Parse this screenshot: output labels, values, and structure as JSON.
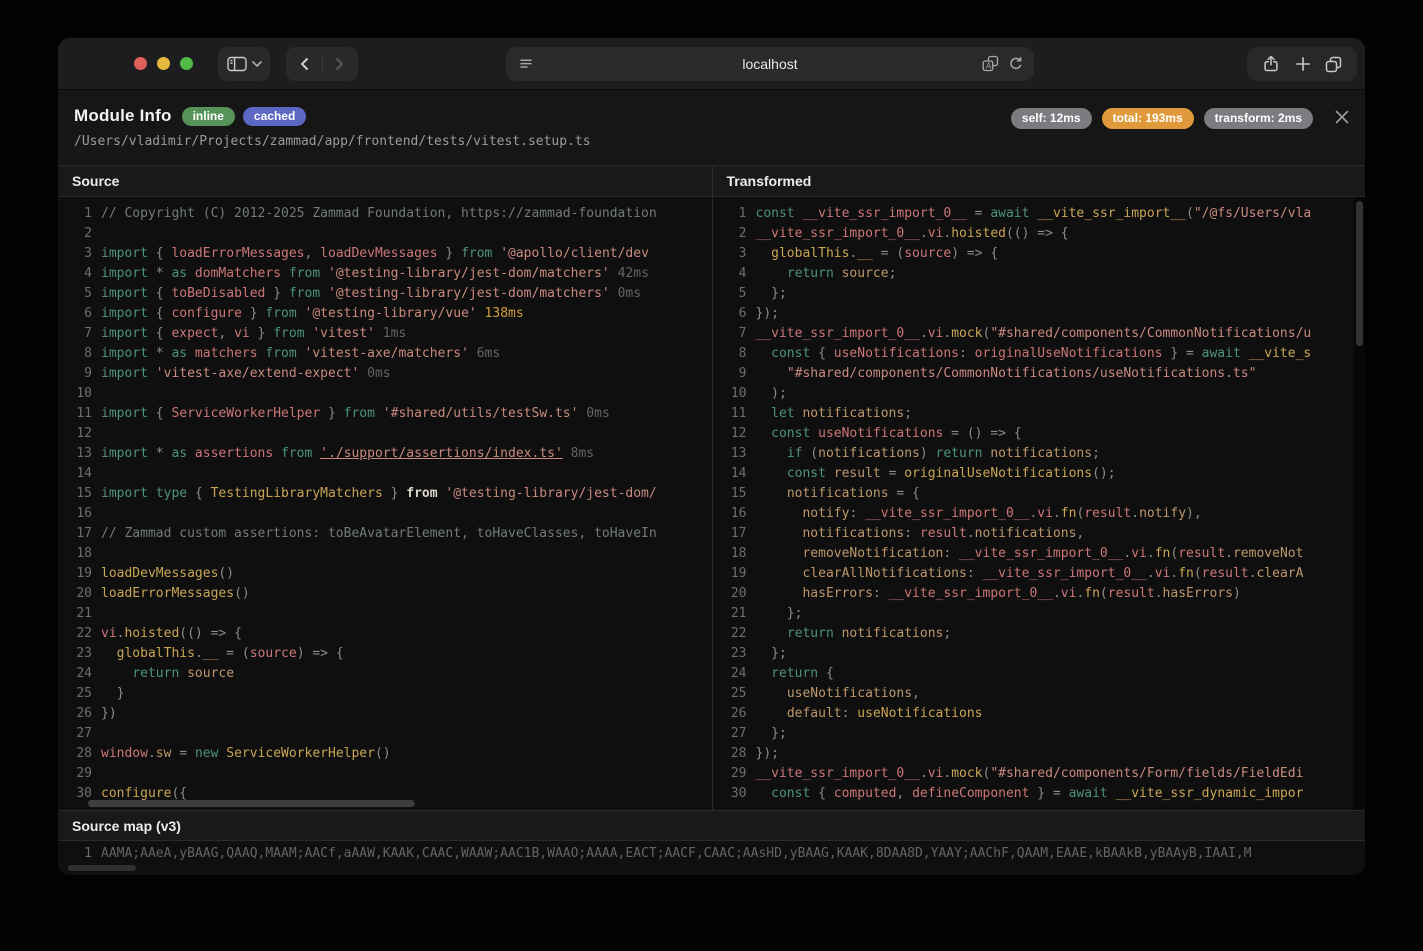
{
  "browser": {
    "url": "localhost",
    "icons": [
      "sidebar",
      "chevron-down",
      "back",
      "forward",
      "reader",
      "translate",
      "reload",
      "share",
      "new-tab",
      "tab-overview"
    ]
  },
  "header": {
    "title": "Module Info",
    "badges": [
      {
        "label": "inline",
        "color": "#569358"
      },
      {
        "label": "cached",
        "color": "#5c68c4"
      }
    ],
    "path": "/Users/vladimir/Projects/zammad/app/frontend/tests/vitest.setup.ts",
    "timings": [
      {
        "label": "self: 12ms",
        "color": "#7b7b80"
      },
      {
        "label": "total: 193ms",
        "color": "#e09a3c"
      },
      {
        "label": "transform: 2ms",
        "color": "#7b7b80"
      }
    ]
  },
  "panels": {
    "source": {
      "title": "Source",
      "lines": [
        [
          [
            "cm",
            "// Copyright (C) 2012-2025 Zammad Foundation, https://zammad-foundation"
          ]
        ],
        [],
        [
          [
            "kw",
            "import"
          ],
          [
            "pn",
            " { "
          ],
          [
            "id",
            "loadErrorMessages"
          ],
          [
            "pn",
            ", "
          ],
          [
            "id",
            "loadDevMessages"
          ],
          [
            "pn",
            " } "
          ],
          [
            "kw",
            "from"
          ],
          [
            "str",
            " '@apollo/client/dev"
          ]
        ],
        [
          [
            "kw",
            "import"
          ],
          [
            "pn",
            " * "
          ],
          [
            "kw",
            "as"
          ],
          [
            "id",
            " domMatchers "
          ],
          [
            "kw",
            "from"
          ],
          [
            "str",
            " '@testing-library/jest-dom/matchers'"
          ],
          [
            "tm",
            " 42ms"
          ]
        ],
        [
          [
            "kw",
            "import"
          ],
          [
            "pn",
            " { "
          ],
          [
            "id",
            "toBeDisabled"
          ],
          [
            "pn",
            " } "
          ],
          [
            "kw",
            "from"
          ],
          [
            "str",
            " '@testing-library/jest-dom/matchers'"
          ],
          [
            "tm",
            " 0ms"
          ]
        ],
        [
          [
            "kw",
            "import"
          ],
          [
            "pn",
            " { "
          ],
          [
            "id",
            "configure"
          ],
          [
            "pn",
            " } "
          ],
          [
            "kw",
            "from"
          ],
          [
            "str",
            " '@testing-library/vue'"
          ],
          [
            "hl",
            " 138ms"
          ]
        ],
        [
          [
            "kw",
            "import"
          ],
          [
            "pn",
            " { "
          ],
          [
            "id",
            "expect"
          ],
          [
            "pn",
            ", "
          ],
          [
            "id",
            "vi"
          ],
          [
            "pn",
            " } "
          ],
          [
            "kw",
            "from"
          ],
          [
            "str",
            " 'vitest'"
          ],
          [
            "tm",
            " 1ms"
          ]
        ],
        [
          [
            "kw",
            "import"
          ],
          [
            "pn",
            " * "
          ],
          [
            "kw",
            "as"
          ],
          [
            "id",
            " matchers "
          ],
          [
            "kw",
            "from"
          ],
          [
            "str",
            " 'vitest-axe/matchers'"
          ],
          [
            "tm",
            " 6ms"
          ]
        ],
        [
          [
            "kw",
            "import"
          ],
          [
            "str",
            " 'vitest-axe/extend-expect'"
          ],
          [
            "tm",
            " 0ms"
          ]
        ],
        [],
        [
          [
            "kw",
            "import"
          ],
          [
            "pn",
            " { "
          ],
          [
            "id",
            "ServiceWorkerHelper"
          ],
          [
            "pn",
            " } "
          ],
          [
            "kw",
            "from"
          ],
          [
            "str",
            " '#shared/utils/testSw.ts'"
          ],
          [
            "tm",
            " 0ms"
          ]
        ],
        [],
        [
          [
            "kw",
            "import"
          ],
          [
            "pn",
            " * "
          ],
          [
            "kw",
            "as"
          ],
          [
            "id",
            " assertions "
          ],
          [
            "kw",
            "from"
          ],
          [
            "pn",
            " "
          ],
          [
            "lk",
            "'./support/assertions/index.ts'"
          ],
          [
            "tm",
            " 8ms"
          ]
        ],
        [],
        [
          [
            "kw",
            "import type"
          ],
          [
            "pn",
            " { "
          ],
          [
            "fn",
            "TestingLibraryMatchers"
          ],
          [
            "pn",
            " } "
          ],
          [
            "wb",
            "from"
          ],
          [
            "str",
            " '@testing-library/jest-dom/"
          ]
        ],
        [],
        [
          [
            "cm",
            "// Zammad custom assertions: toBeAvatarElement, toHaveClasses, toHaveIn"
          ]
        ],
        [],
        [
          [
            "fn",
            "loadDevMessages"
          ],
          [
            "pn",
            "()"
          ]
        ],
        [
          [
            "fn",
            "loadErrorMessages"
          ],
          [
            "pn",
            "()"
          ]
        ],
        [],
        [
          [
            "id",
            "vi"
          ],
          [
            "pn",
            "."
          ],
          [
            "fn",
            "hoisted"
          ],
          [
            "pn",
            "(() => {"
          ]
        ],
        [
          [
            "pn",
            "  "
          ],
          [
            "fn",
            "globalThis"
          ],
          [
            "pn",
            "."
          ],
          [
            "vr",
            "__"
          ],
          [
            "pn",
            " = ("
          ],
          [
            "id",
            "source"
          ],
          [
            "pn",
            ") => {"
          ]
        ],
        [
          [
            "pn",
            "    "
          ],
          [
            "kw",
            "return"
          ],
          [
            "vr",
            " source"
          ]
        ],
        [
          [
            "pn",
            "  }"
          ]
        ],
        [
          [
            "pn",
            "})"
          ]
        ],
        [],
        [
          [
            "id",
            "window"
          ],
          [
            "pn",
            "."
          ],
          [
            "vr",
            "sw"
          ],
          [
            "pn",
            " = "
          ],
          [
            "kw",
            "new"
          ],
          [
            "fn",
            " ServiceWorkerHelper"
          ],
          [
            "pn",
            "()"
          ]
        ],
        [],
        [
          [
            "fn",
            "configure"
          ],
          [
            "pn",
            "({"
          ]
        ]
      ]
    },
    "transformed": {
      "title": "Transformed",
      "lines": [
        [
          [
            "kw",
            "const "
          ],
          [
            "id",
            "__vite_ssr_import_0__"
          ],
          [
            "pn",
            " = "
          ],
          [
            "kw",
            "await "
          ],
          [
            "fn",
            "__vite_ssr_import__"
          ],
          [
            "pn",
            "("
          ],
          [
            "str",
            "\"/@fs/Users/vla"
          ]
        ],
        [
          [
            "id",
            "__vite_ssr_import_0__"
          ],
          [
            "pn",
            "."
          ],
          [
            "id",
            "vi"
          ],
          [
            "pn",
            "."
          ],
          [
            "fn",
            "hoisted"
          ],
          [
            "pn",
            "(() => {"
          ]
        ],
        [
          [
            "pn",
            "  "
          ],
          [
            "fn",
            "globalThis"
          ],
          [
            "pn",
            "."
          ],
          [
            "vr",
            "__"
          ],
          [
            "pn",
            " = ("
          ],
          [
            "id",
            "source"
          ],
          [
            "pn",
            ") => {"
          ]
        ],
        [
          [
            "pn",
            "    "
          ],
          [
            "kw",
            "return"
          ],
          [
            "vr",
            " source"
          ],
          [
            "pn",
            ";"
          ]
        ],
        [
          [
            "pn",
            "  };"
          ]
        ],
        [
          [
            "pn",
            "});"
          ]
        ],
        [
          [
            "id",
            "__vite_ssr_import_0__"
          ],
          [
            "pn",
            "."
          ],
          [
            "id",
            "vi"
          ],
          [
            "pn",
            "."
          ],
          [
            "fn",
            "mock"
          ],
          [
            "pn",
            "("
          ],
          [
            "str",
            "\"#shared/components/CommonNotifications/u"
          ]
        ],
        [
          [
            "pn",
            "  "
          ],
          [
            "kw",
            "const"
          ],
          [
            "pn",
            " { "
          ],
          [
            "id",
            "useNotifications"
          ],
          [
            "pn",
            ": "
          ],
          [
            "id",
            "originalUseNotifications"
          ],
          [
            "pn",
            " } = "
          ],
          [
            "kw",
            "await "
          ],
          [
            "fn",
            "__vite_s"
          ]
        ],
        [
          [
            "pn",
            "    "
          ],
          [
            "str",
            "\"#shared/components/CommonNotifications/useNotifications.ts\""
          ]
        ],
        [
          [
            "pn",
            "  );"
          ]
        ],
        [
          [
            "pn",
            "  "
          ],
          [
            "kw",
            "let"
          ],
          [
            "vr",
            " notifications"
          ],
          [
            "pn",
            ";"
          ]
        ],
        [
          [
            "pn",
            "  "
          ],
          [
            "kw",
            "const "
          ],
          [
            "id",
            "useNotifications"
          ],
          [
            "pn",
            " = () => {"
          ]
        ],
        [
          [
            "pn",
            "    "
          ],
          [
            "kw",
            "if"
          ],
          [
            "pn",
            " ("
          ],
          [
            "vr",
            "notifications"
          ],
          [
            "pn",
            ") "
          ],
          [
            "kw",
            "return"
          ],
          [
            "vr",
            " notifications"
          ],
          [
            "pn",
            ";"
          ]
        ],
        [
          [
            "pn",
            "    "
          ],
          [
            "kw",
            "const "
          ],
          [
            "vr",
            "result"
          ],
          [
            "pn",
            " = "
          ],
          [
            "fn",
            "originalUseNotifications"
          ],
          [
            "pn",
            "();"
          ]
        ],
        [
          [
            "pn",
            "    "
          ],
          [
            "vr",
            "notifications"
          ],
          [
            "pn",
            " = {"
          ]
        ],
        [
          [
            "pn",
            "      "
          ],
          [
            "vr",
            "notify"
          ],
          [
            "pn",
            ": "
          ],
          [
            "id",
            "__vite_ssr_import_0__"
          ],
          [
            "pn",
            "."
          ],
          [
            "id",
            "vi"
          ],
          [
            "pn",
            "."
          ],
          [
            "fn",
            "fn"
          ],
          [
            "pn",
            "("
          ],
          [
            "id",
            "result"
          ],
          [
            "pn",
            "."
          ],
          [
            "vr",
            "notify"
          ],
          [
            "pn",
            "),"
          ]
        ],
        [
          [
            "pn",
            "      "
          ],
          [
            "vr",
            "notifications"
          ],
          [
            "pn",
            ": "
          ],
          [
            "id",
            "result"
          ],
          [
            "pn",
            "."
          ],
          [
            "vr",
            "notifications"
          ],
          [
            "pn",
            ","
          ]
        ],
        [
          [
            "pn",
            "      "
          ],
          [
            "vr",
            "removeNotification"
          ],
          [
            "pn",
            ": "
          ],
          [
            "id",
            "__vite_ssr_import_0__"
          ],
          [
            "pn",
            "."
          ],
          [
            "id",
            "vi"
          ],
          [
            "pn",
            "."
          ],
          [
            "fn",
            "fn"
          ],
          [
            "pn",
            "("
          ],
          [
            "id",
            "result"
          ],
          [
            "pn",
            "."
          ],
          [
            "vr",
            "removeNot"
          ]
        ],
        [
          [
            "pn",
            "      "
          ],
          [
            "vr",
            "clearAllNotifications"
          ],
          [
            "pn",
            ": "
          ],
          [
            "id",
            "__vite_ssr_import_0__"
          ],
          [
            "pn",
            "."
          ],
          [
            "id",
            "vi"
          ],
          [
            "pn",
            "."
          ],
          [
            "fn",
            "fn"
          ],
          [
            "pn",
            "("
          ],
          [
            "id",
            "result"
          ],
          [
            "pn",
            "."
          ],
          [
            "vr",
            "clearA"
          ]
        ],
        [
          [
            "pn",
            "      "
          ],
          [
            "vr",
            "hasErrors"
          ],
          [
            "pn",
            ": "
          ],
          [
            "id",
            "__vite_ssr_import_0__"
          ],
          [
            "pn",
            "."
          ],
          [
            "id",
            "vi"
          ],
          [
            "pn",
            "."
          ],
          [
            "fn",
            "fn"
          ],
          [
            "pn",
            "("
          ],
          [
            "id",
            "result"
          ],
          [
            "pn",
            "."
          ],
          [
            "vr",
            "hasErrors"
          ],
          [
            "pn",
            ")"
          ]
        ],
        [
          [
            "pn",
            "    };"
          ]
        ],
        [
          [
            "pn",
            "    "
          ],
          [
            "kw",
            "return"
          ],
          [
            "vr",
            " notifications"
          ],
          [
            "pn",
            ";"
          ]
        ],
        [
          [
            "pn",
            "  };"
          ]
        ],
        [
          [
            "pn",
            "  "
          ],
          [
            "kw",
            "return"
          ],
          [
            "pn",
            " {"
          ]
        ],
        [
          [
            "pn",
            "    "
          ],
          [
            "vr",
            "useNotifications"
          ],
          [
            "pn",
            ","
          ]
        ],
        [
          [
            "pn",
            "    "
          ],
          [
            "vr",
            "default"
          ],
          [
            "pn",
            ": "
          ],
          [
            "fn",
            "useNotifications"
          ]
        ],
        [
          [
            "pn",
            "  };"
          ]
        ],
        [
          [
            "pn",
            "});"
          ]
        ],
        [
          [
            "id",
            "__vite_ssr_import_0__"
          ],
          [
            "pn",
            "."
          ],
          [
            "id",
            "vi"
          ],
          [
            "pn",
            "."
          ],
          [
            "fn",
            "mock"
          ],
          [
            "pn",
            "("
          ],
          [
            "str",
            "\"#shared/components/Form/fields/FieldEdi"
          ]
        ],
        [
          [
            "pn",
            "  "
          ],
          [
            "kw",
            "const"
          ],
          [
            "pn",
            " { "
          ],
          [
            "id",
            "computed"
          ],
          [
            "pn",
            ", "
          ],
          [
            "id",
            "defineComponent"
          ],
          [
            "pn",
            " } = "
          ],
          [
            "kw",
            "await "
          ],
          [
            "fn",
            "__vite_ssr_dynamic_impor"
          ]
        ]
      ]
    }
  },
  "sourcemap": {
    "title": "Source map (v3)",
    "lines": [
      [
        [
          "tm",
          "AAMA;AAeA,yBAAG,QAAQ,MAAM;AACf,aAAW,KAAK,CAAC,WAAW;AAC1B,WAAO;AAAA,EACT;AACF,CAAC;AAsHD,yBAAG,KAAK,8DAA8D,YAAY;AAChF,QAAM,EAAE,kBAAkB,yBAAyB,IAAI,M"
        ]
      ]
    ]
  }
}
